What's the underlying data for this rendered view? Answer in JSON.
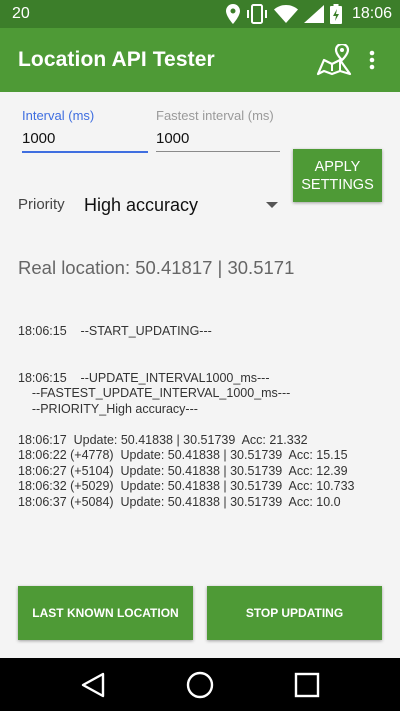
{
  "status_bar": {
    "notification": "20",
    "time": "18:06",
    "icons": [
      "location-pin-icon",
      "phone-vibrate-icon",
      "wifi-icon",
      "cell-signal-icon",
      "battery-charging-icon"
    ]
  },
  "app_bar": {
    "title": "Location API Tester",
    "icons": [
      "map-icon",
      "overflow-menu-icon"
    ],
    "color": "#4e9a36",
    "status_color": "#3c7e2a"
  },
  "settings": {
    "interval": {
      "label": "Interval (ms)",
      "value": "1000"
    },
    "fastest_interval": {
      "label": "Fastest interval (ms)",
      "value": "1000"
    },
    "apply_button": {
      "line1": "APPLY",
      "line2": "SETTINGS"
    },
    "priority": {
      "label": "Priority",
      "value": "High accuracy"
    }
  },
  "real_location": "Real location: 50.41817 | 30.5171",
  "log": [
    "18:06:15    --START_UPDATING---",
    "",
    "",
    "18:06:15    --UPDATE_INTERVAL1000_ms---",
    "    --FASTEST_UPDATE_INTERVAL_1000_ms---",
    "    --PRIORITY_High accuracy---",
    "",
    "18:06:17  Update: 50.41838 | 30.51739  Acc: 21.332",
    "18:06:22 (+4778)  Update: 50.41838 | 30.51739  Acc: 15.15",
    "18:06:27 (+5104)  Update: 50.41838 | 30.51739  Acc: 12.39",
    "18:06:32 (+5029)  Update: 50.41838 | 30.51739  Acc: 10.733",
    "18:06:37 (+5084)  Update: 50.41838 | 30.51739  Acc: 10.0"
  ],
  "bottom_buttons": {
    "last_known": "LAST KNOWN LOCATION",
    "stop_updating": "STOP UPDATING"
  },
  "nav_bar": {
    "icons": [
      "back-icon",
      "home-icon",
      "recents-icon"
    ]
  },
  "colors": {
    "accent_focus": "#3f6ee0",
    "background": "#f4f4f4"
  }
}
